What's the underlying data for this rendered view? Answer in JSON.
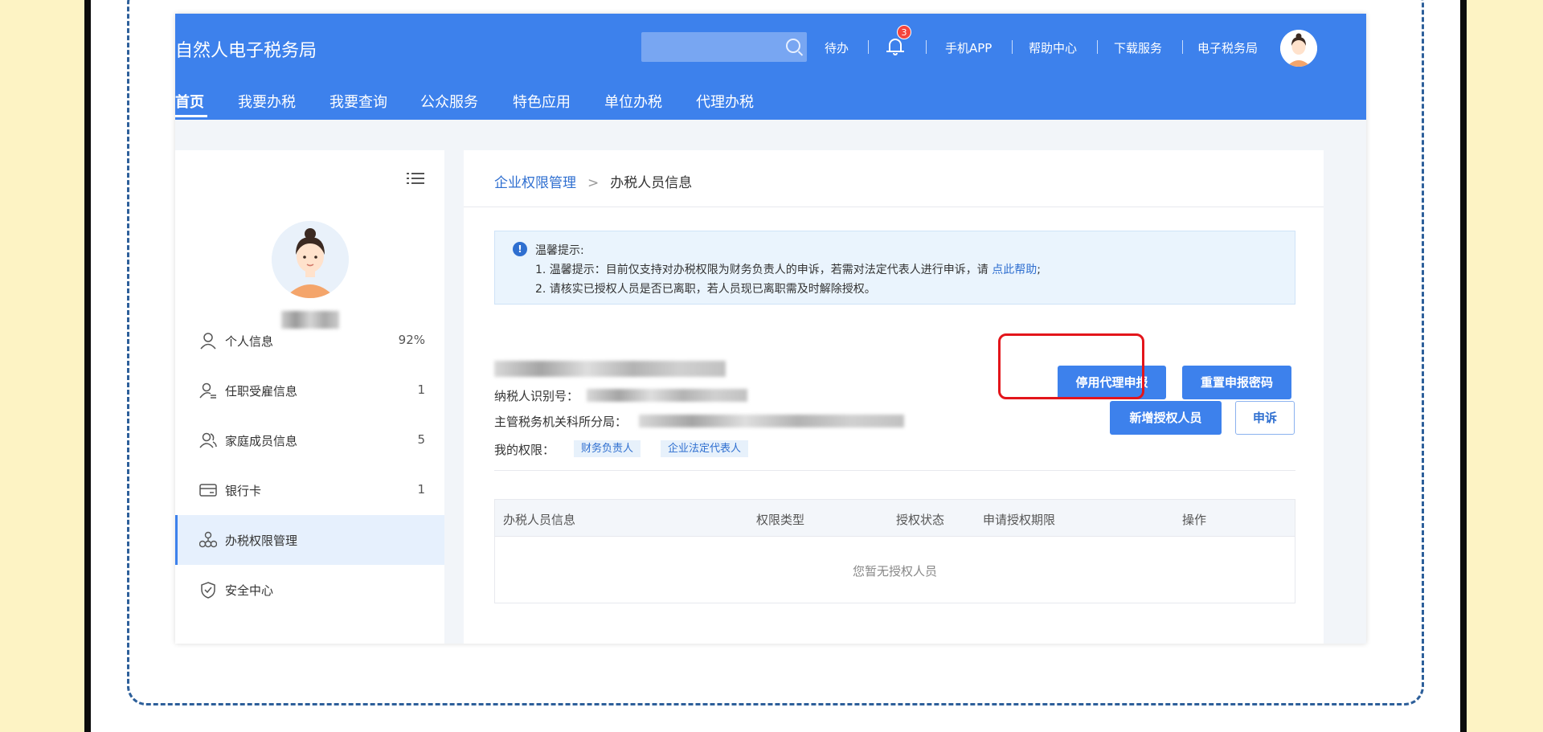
{
  "header": {
    "app_title": "自然人电子税务局",
    "search_placeholder": "",
    "todo": "待办",
    "notification_count": "3",
    "mobile_app": "手机APP",
    "help_center": "帮助中心",
    "download_service": "下载服务",
    "e_tax_bureau": "电子税务局"
  },
  "main_nav": [
    {
      "label": "首页",
      "active": true
    },
    {
      "label": "我要办税"
    },
    {
      "label": "我要查询"
    },
    {
      "label": "公众服务"
    },
    {
      "label": "特色应用"
    },
    {
      "label": "单位办税"
    },
    {
      "label": "代理办税"
    }
  ],
  "sidebar": {
    "items": [
      {
        "label": "个人信息",
        "count": "92%",
        "icon": "user-icon"
      },
      {
        "label": "任职受雇信息",
        "count": "1",
        "icon": "user-list-icon"
      },
      {
        "label": "家庭成员信息",
        "count": "5",
        "icon": "family-icon"
      },
      {
        "label": "银行卡",
        "count": "1",
        "icon": "card-icon"
      },
      {
        "label": "办税权限管理",
        "count": "",
        "icon": "org-icon",
        "active": true
      },
      {
        "label": "安全中心",
        "count": "",
        "icon": "shield-icon"
      }
    ]
  },
  "breadcrumb": {
    "parent": "企业权限管理",
    "separator": ">",
    "current": "办税人员信息"
  },
  "notice": {
    "icon": "info-icon",
    "title": "温馨提示:",
    "line1": "1. 温馨提示：目前仅支持对办税权限为财务负责人的申诉，若需对法定代表人进行申诉，请 ",
    "line1_link": "点此帮助",
    "line1_end": ";",
    "line2": "2. 请核实已授权人员是否已离职，若人员现已离职需及时解除授权。"
  },
  "company": {
    "taxpayer_id_label": "纳税人识别号：",
    "tax_authority_label": "主管税务机关科所分局：",
    "permissions_label": "我的权限：",
    "permissions": [
      "财务负责人",
      "企业法定代表人"
    ]
  },
  "actions": {
    "stop_agent": "停用代理申报",
    "reset_password": "重置申报密码",
    "add_authorized": "新增授权人员",
    "appeal": "申诉"
  },
  "table": {
    "headers": [
      "办税人员信息",
      "权限类型",
      "授权状态",
      "申请授权期限",
      "操作"
    ],
    "empty_text": "您暂无授权人员"
  },
  "colors": {
    "brand_blue": "#3d81ec",
    "highlight_red": "#e3151b",
    "page_yellow": "#fdf3c4"
  }
}
